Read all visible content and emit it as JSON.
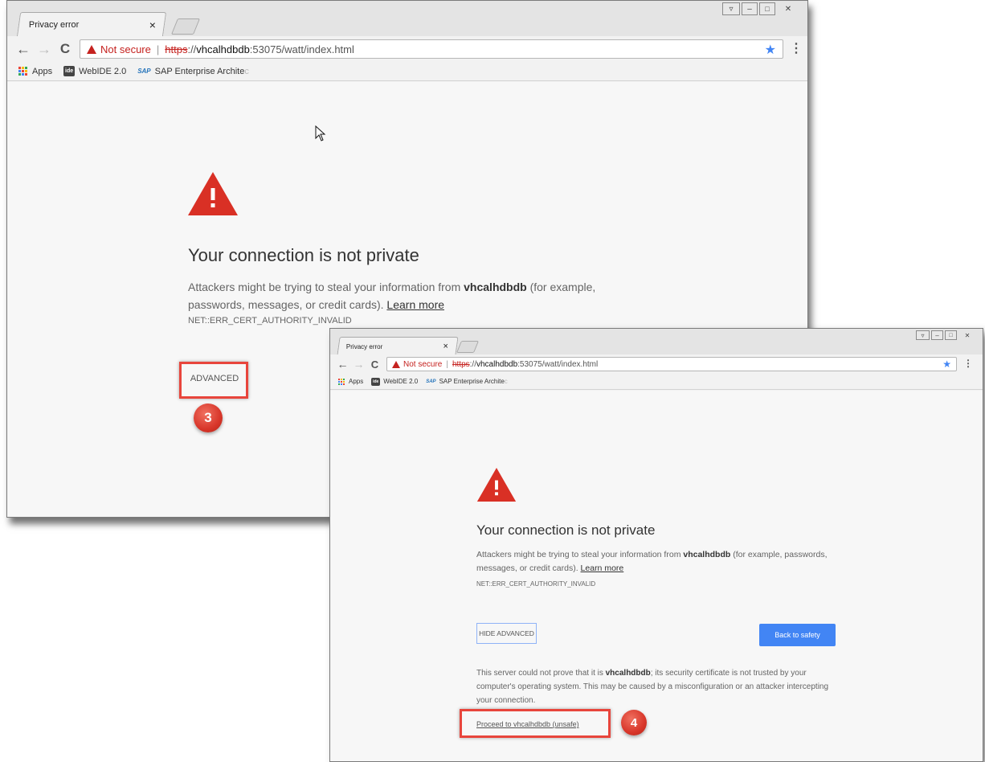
{
  "browser": {
    "tab_title": "Privacy error",
    "tab_close": "×",
    "not_secure": "Not secure",
    "separator": "|",
    "url_scheme": "https",
    "url_host_prefix": "://",
    "url_host": "vhcalhdbdb",
    "url_rest": ":53075/watt/index.html",
    "bookmarks": {
      "apps": "Apps",
      "webide": "WebIDE 2.0",
      "webide_icon": "ide",
      "sap": "SAP Enterprise Archite",
      "sap_icon": "SAP"
    },
    "icons": {
      "back": "back-arrow-icon",
      "forward": "forward-arrow-icon",
      "reload": "reload-icon",
      "star": "bookmark-star-icon",
      "menu": "menu-dots-icon"
    }
  },
  "error_page": {
    "heading": "Your connection is not private",
    "para_prefix": "Attackers might be trying to steal your information from ",
    "para_host": "vhcalhdbdb",
    "para_suffix": " (for example, passwords, messages, or credit cards). ",
    "learn_more": "Learn more",
    "error_code": "NET::ERR_CERT_AUTHORITY_INVALID",
    "advanced_button": "ADVANCED",
    "hide_advanced_button": "HIDE ADVANCED",
    "back_to_safety_button": "Back to safety",
    "advanced_prefix": "This server could not prove that it is ",
    "advanced_host": "vhcalhdbdb",
    "advanced_suffix": "; its security certificate is not trusted by your computer's operating system. This may be caused by a misconfiguration or an attacker intercepting your connection.",
    "proceed_link": "Proceed to vhcalhdbdb (unsafe)"
  },
  "annotations": {
    "step3": "3",
    "step4": "4"
  },
  "colors": {
    "warning_red": "#c5221f",
    "highlight_red": "#e8453c",
    "primary_blue": "#4285f4"
  }
}
